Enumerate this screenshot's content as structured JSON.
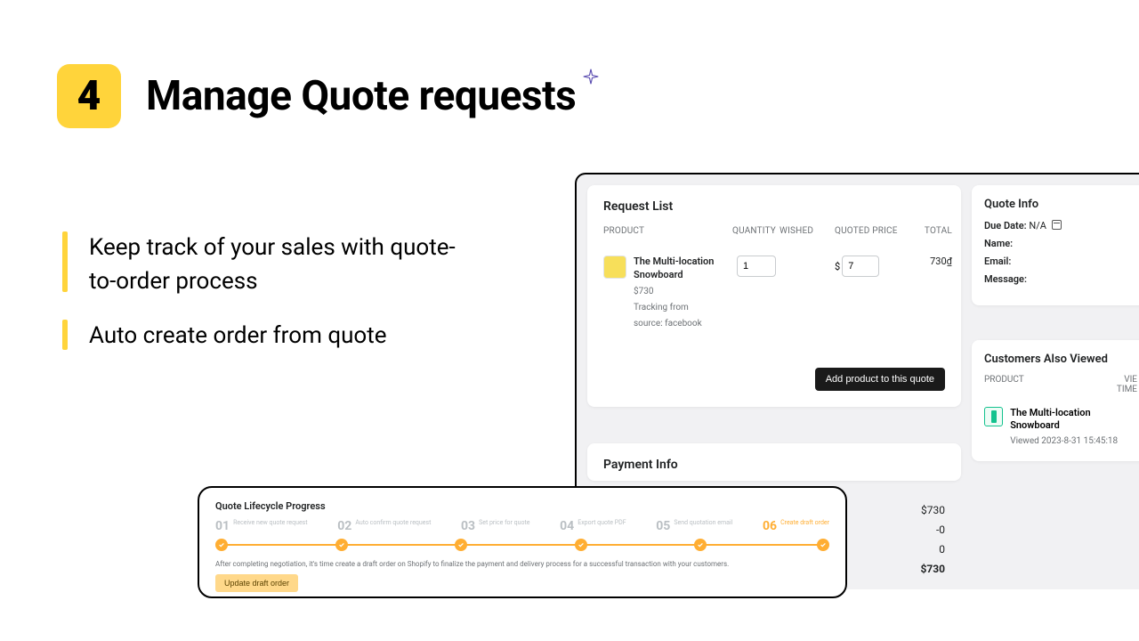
{
  "header": {
    "step_number": "4",
    "title": "Manage Quote requests"
  },
  "bullets": [
    "Keep track of your sales with quote-to-order process",
    "Auto create order from quote"
  ],
  "request_list": {
    "title": "Request List",
    "columns": {
      "product": "PRODUCT",
      "quantity": "QUANTITY",
      "wished": "WISHED",
      "quoted": "QUOTED PRICE",
      "total": "TOTAL"
    },
    "row": {
      "name": "The Multi-location Snowboard",
      "price": "$730",
      "tracking_l1": "Tracking from",
      "tracking_l2": "source: facebook",
      "qty": "1",
      "quoted_prefix": "$",
      "quoted_val": "7",
      "total": "730₫"
    },
    "add_button": "Add product to this quote"
  },
  "payment": {
    "title": "Payment Info",
    "lines": {
      "subtotal": "$730",
      "discount": "-0",
      "zero": "0",
      "total": "$730"
    }
  },
  "quote_info": {
    "title": "Quote Info",
    "due_label": "Due Date:",
    "due_val": "N/A",
    "name_label": "Name:",
    "email_label": "Email:",
    "message_label": "Message:"
  },
  "also": {
    "title": "Customers Also Viewed",
    "col_product": "PRODUCT",
    "col_view": "VIE",
    "col_time": "TIME",
    "item": {
      "name": "The Multi-location Snowboard",
      "viewed": "Viewed 2023-8-31 15:45:18"
    }
  },
  "lifecycle": {
    "title": "Quote Lifecycle Progress",
    "steps": [
      {
        "num": "01",
        "label": "Receive new quote request"
      },
      {
        "num": "02",
        "label": "Auto confirm quote request"
      },
      {
        "num": "03",
        "label": "Set price for quote"
      },
      {
        "num": "04",
        "label": "Export quote PDF"
      },
      {
        "num": "05",
        "label": "Send quotation email"
      },
      {
        "num": "06",
        "label": "Create draft order"
      }
    ],
    "description": "After completing negotiation, it's time create a draft order on Shopify to finalize the payment and delivery process for a successful transaction with your customers.",
    "button": "Update draft order"
  }
}
